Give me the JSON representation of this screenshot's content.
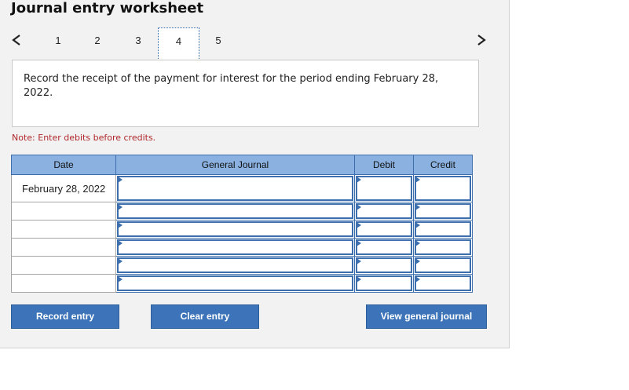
{
  "worksheet": {
    "title": "Journal entry worksheet",
    "steps": [
      "1",
      "2",
      "3",
      "4",
      "5"
    ],
    "active_step": "4",
    "instruction": "Record the receipt of the payment for interest for the period ending February 28, 2022.",
    "note": "Note: Enter debits before credits."
  },
  "table": {
    "headers": {
      "date": "Date",
      "journal": "General Journal",
      "debit": "Debit",
      "credit": "Credit"
    },
    "rows": [
      {
        "date": "February 28, 2022"
      },
      {
        "date": ""
      },
      {
        "date": ""
      },
      {
        "date": ""
      },
      {
        "date": ""
      },
      {
        "date": ""
      }
    ]
  },
  "buttons": {
    "record": "Record entry",
    "clear": "Clear entry",
    "view": "View general journal"
  },
  "colors": {
    "header_fill": "#8ab1e0",
    "button_fill": "#3d74b9",
    "note_text": "#b0272b"
  }
}
